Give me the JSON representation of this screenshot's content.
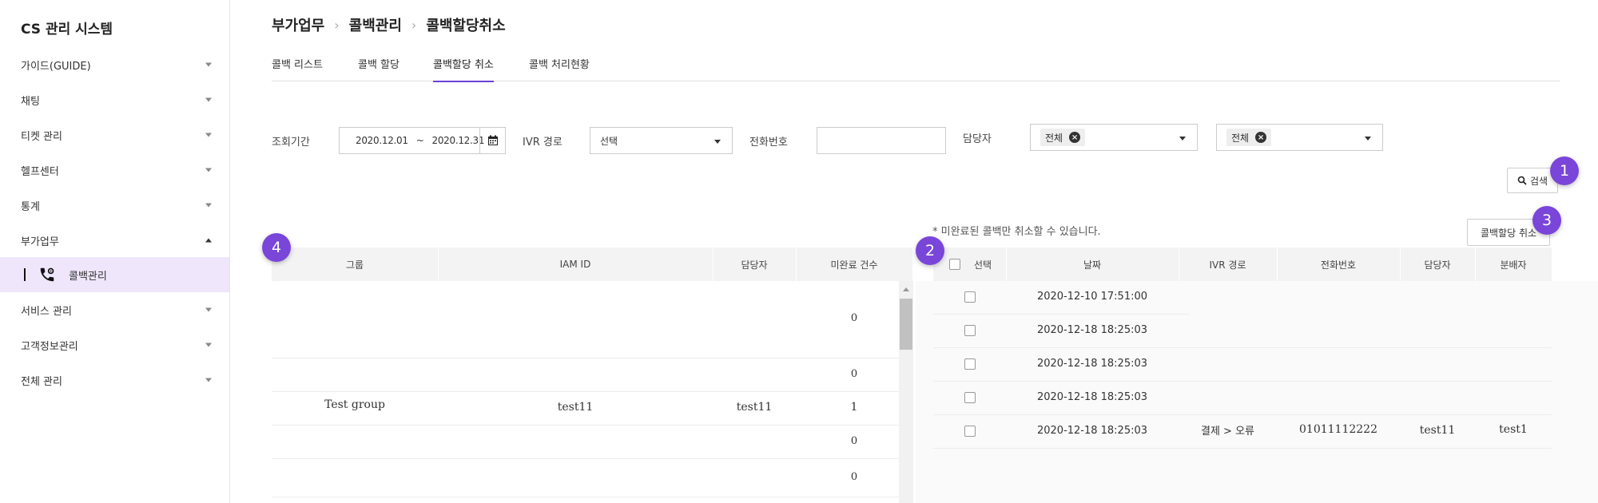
{
  "app": {
    "title": "CS 관리 시스템"
  },
  "sidebar": {
    "items": [
      {
        "label": "가이드(GUIDE)",
        "expanded": false
      },
      {
        "label": "채팅",
        "expanded": false
      },
      {
        "label": "티켓 관리",
        "expanded": false
      },
      {
        "label": "헬프센터",
        "expanded": false
      },
      {
        "label": "통계",
        "expanded": false
      },
      {
        "label": "부가업무",
        "expanded": true
      },
      {
        "label": "서비스 관리",
        "expanded": false
      },
      {
        "label": "고객정보관리",
        "expanded": false
      },
      {
        "label": "전체 관리",
        "expanded": false
      }
    ],
    "sub_item": {
      "label": "콜백관리",
      "icon": "phone-settings-icon"
    }
  },
  "breadcrumb": [
    "부가업무",
    "콜백관리",
    "콜백할당취소"
  ],
  "tabs": [
    {
      "label": "콜백 리스트",
      "active": false
    },
    {
      "label": "콜백 할당",
      "active": false
    },
    {
      "label": "콜백할당 취소",
      "active": true
    },
    {
      "label": "콜백 처리현황",
      "active": false
    }
  ],
  "filters": {
    "period_label": "조회기간",
    "date_from": "2020.12.01",
    "date_sep": "~",
    "date_to": "2020.12.31",
    "ivr_label": "IVR 경로",
    "ivr_value": "선택",
    "phone_label": "전화번호",
    "phone_value": "",
    "agent_label": "담당자",
    "agent_tag_1": "전체",
    "agent_tag_2": "전체"
  },
  "buttons": {
    "search": "검색",
    "cancel_assign": "콜백할당 취소"
  },
  "badges": [
    "1",
    "2",
    "3",
    "4"
  ],
  "notice": "* 미완료된 콜백만 취소할 수 있습니다.",
  "left_table": {
    "headers": [
      "그룹",
      "IAM ID",
      "담당자",
      "미완료 건수"
    ],
    "rows": [
      {
        "group": "",
        "iam_id": "",
        "agent": "",
        "count": "0"
      },
      {
        "group": "",
        "iam_id": "",
        "agent": "",
        "count": "0"
      },
      {
        "group": "Test group",
        "iam_id": "test11",
        "agent": "test11",
        "count": "1"
      },
      {
        "group": "",
        "iam_id": "",
        "agent": "",
        "count": "0"
      },
      {
        "group": "",
        "iam_id": "",
        "agent": "",
        "count": "0"
      }
    ]
  },
  "right_table": {
    "headers": [
      "선택",
      "날짜",
      "IVR 경로",
      "전화번호",
      "담당자",
      "분배자"
    ],
    "rows": [
      {
        "date": "2020-12-10 17:51:00",
        "ivr": "",
        "phone": "",
        "agent": "",
        "distributor": ""
      },
      {
        "date": "2020-12-18 18:25:03",
        "ivr": "",
        "phone": "",
        "agent": "",
        "distributor": ""
      },
      {
        "date": "2020-12-18 18:25:03",
        "ivr": "",
        "phone": "",
        "agent": "",
        "distributor": ""
      },
      {
        "date": "2020-12-18 18:25:03",
        "ivr": "",
        "phone": "",
        "agent": "",
        "distributor": ""
      },
      {
        "date": "2020-12-18 18:25:03",
        "ivr": "결제 > 오류",
        "phone": "01011112222",
        "agent": "test11",
        "distributor": "test1"
      }
    ]
  },
  "colors": {
    "accent": "#6b3fd6",
    "badge": "#7a45d9",
    "sidebar_active": "#efe6fb"
  }
}
